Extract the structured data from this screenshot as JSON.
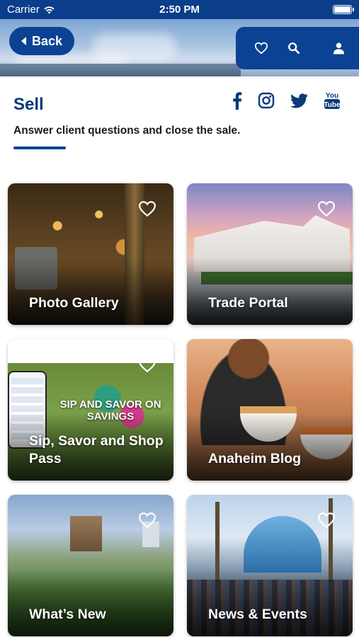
{
  "status_bar": {
    "carrier": "Carrier",
    "time": "2:50 PM"
  },
  "header": {
    "back_label": "Back",
    "actions": [
      "heart-icon",
      "search-icon",
      "user-icon"
    ]
  },
  "intro": {
    "title": "Sell",
    "subtitle": "Answer client questions and close the sale.",
    "social": [
      "facebook-icon",
      "instagram-icon",
      "twitter-icon",
      "youtube-icon"
    ]
  },
  "cards": {
    "photo_gallery": {
      "label": "Photo Gallery"
    },
    "trade_portal": {
      "label": "Trade Portal"
    },
    "sip_savor": {
      "label": "Sip, Savor and Shop Pass",
      "promo": "SIP AND SAVOR ON SAVINGS"
    },
    "anaheim_blog": {
      "label": "Anaheim Blog"
    },
    "whats_new": {
      "label": "What’s New"
    },
    "news_events": {
      "label": "News & Events"
    }
  },
  "colors": {
    "brand_blue": "#0b4293",
    "title_blue": "#0b3a7a"
  }
}
